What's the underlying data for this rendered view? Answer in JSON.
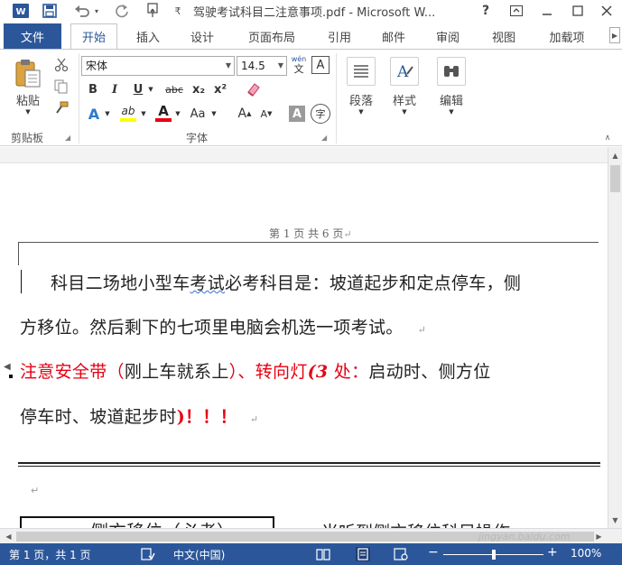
{
  "window": {
    "title": "驾驶考试科目二注意事项.pdf - Microsoft W...",
    "help": "?",
    "buttons": [
      "restore-ribbon",
      "minimize",
      "maximize",
      "close"
    ]
  },
  "quick_access": {
    "icons": [
      "word-logo-icon",
      "save-icon",
      "undo-icon",
      "redo-icon",
      "touch-mode-icon",
      "customize-icon"
    ],
    "undo_caret": "▾",
    "customize_glyph": "₹"
  },
  "tabs": {
    "file": "文件",
    "items": [
      "开始",
      "插入",
      "设计",
      "页面布局",
      "引用",
      "邮件",
      "审阅",
      "视图",
      "加载项"
    ],
    "active_index": 0
  },
  "ribbon": {
    "clipboard": {
      "paste_label": "粘贴",
      "group_label": "剪贴板"
    },
    "font": {
      "font_name": "宋体",
      "font_size": "14.5",
      "phonetic_top": "wén",
      "phonetic_bottom": "文",
      "border_char": "A",
      "bold": "B",
      "italic": "I",
      "underline": "U",
      "strike": "abc",
      "subscript": "x₂",
      "superscript": "x²",
      "effects": "A",
      "highlight": "ab",
      "font_color": "A",
      "change_case": "Aa",
      "grow": "A",
      "shrink": "A",
      "shading": "A",
      "enclose": "字",
      "group_label": "字体"
    },
    "paragraph": {
      "label": "段落"
    },
    "styles": {
      "label": "样式"
    },
    "editing": {
      "label": "编辑"
    }
  },
  "document": {
    "header": "第 1 页 共 6 页",
    "paragraph_mark": "↵",
    "line1": "科目二场地小型车考试必考科目是：坡道起步和定点停车，侧",
    "line1_squiggle": "考试",
    "line2": "方移位。然后剩下的七项里电脑会机选一项考试。",
    "line3_red1": "注意安全带（",
    "line3_black1": "刚上车就系上",
    "line3_red2": "）、转向灯",
    "line3_bold": "(3",
    "line3_red3": " 处：",
    "line3_black2": "启动时、侧方位",
    "line4_black": "停车时、坡道起步时",
    "line4_red": ")！！！",
    "heading": "一、侧方移位（必考）",
    "after_heading": "当听到侧方移位科目操作…"
  },
  "status": {
    "page": "第 1 页，共 1 页",
    "language": "中文(中国)",
    "zoom": "100%",
    "zoom_minus": "−",
    "zoom_plus": "+",
    "zoom_level": 0.5
  },
  "watermark": "jingyan.baidu.com",
  "colors": {
    "accent": "#2b579a",
    "red_text": "#e60012",
    "font_color_bar": "#e60012",
    "highlight_bar": "#ffff00"
  }
}
